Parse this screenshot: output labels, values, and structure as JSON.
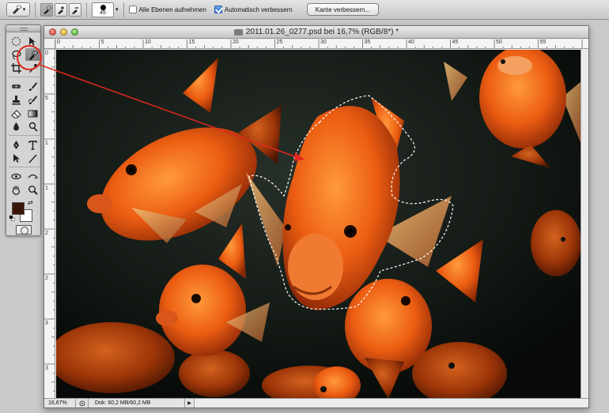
{
  "options_bar": {
    "checkbox_all_layers": {
      "label": "Alle Ebenen aufnehmen",
      "checked": false
    },
    "checkbox_auto_enhance": {
      "label": "Automatisch verbessern",
      "checked": true
    },
    "brush_size": "45",
    "refine_edge_label": "Kante verbessern..."
  },
  "document": {
    "title": "2011.01.26_0277.psd bei 16,7% (RGB/8*) *",
    "ruler_top": [
      "0",
      "5",
      "10",
      "15",
      "20",
      "25",
      "30",
      "35",
      "40",
      "45",
      "50",
      "55"
    ],
    "ruler_left": [
      "0",
      "5",
      "1",
      "1",
      "2",
      "2",
      "3",
      "3"
    ],
    "zoom": "16,67%",
    "doc_size": "Dok: 60,2 MB/60,2 MB"
  },
  "toolbox": {
    "foreground_color": "#3a1408",
    "background_color": "#ffffff",
    "selected_tool": "quick-selection-tool"
  },
  "annotation": {
    "color": "#e0281e"
  }
}
